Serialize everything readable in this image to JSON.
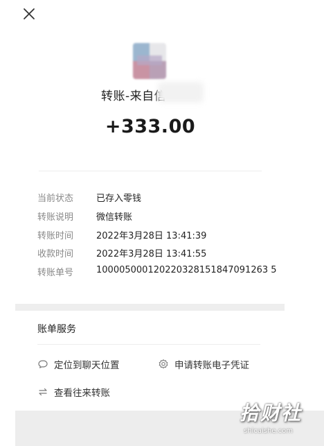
{
  "header": {
    "close_icon": "close-icon"
  },
  "transfer": {
    "sender_label": "转账-来自信",
    "amount": "+333.00"
  },
  "details": [
    {
      "label": "当前状态",
      "value": "已存入零钱"
    },
    {
      "label": "转账说明",
      "value": "微信转账"
    },
    {
      "label": "转账时间",
      "value": "2022年3月28日 13:41:39"
    },
    {
      "label": "收款时间",
      "value": "2022年3月28日 13:41:55"
    },
    {
      "label": "转账单号",
      "value": "100005000120220328151847091263 5"
    }
  ],
  "services": {
    "title": "账单服务",
    "items": [
      {
        "label": "定位到聊天位置",
        "icon": "chat-bubble-icon"
      },
      {
        "label": "申请转账电子凭证",
        "icon": "certificate-icon"
      },
      {
        "label": "查看往来转账",
        "icon": "exchange-arrows-icon"
      }
    ]
  },
  "watermark": {
    "main": "拾财社",
    "sub": "shicaishe.com"
  }
}
